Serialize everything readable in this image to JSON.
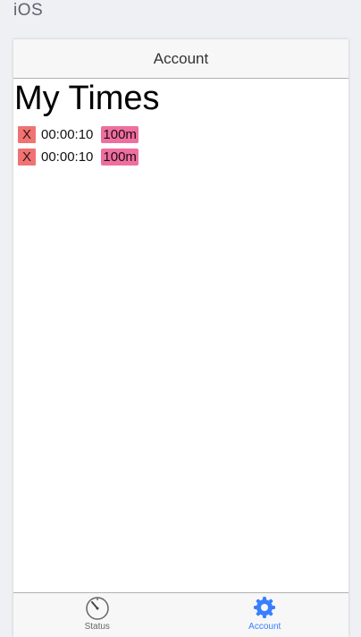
{
  "platform": {
    "label": "iOS"
  },
  "navbar": {
    "title": "Account"
  },
  "main": {
    "title": "My Times",
    "entries": [
      {
        "delete_label": "X",
        "time": "00:00:10",
        "distance": "100m"
      },
      {
        "delete_label": "X",
        "time": "00:00:10",
        "distance": "100m"
      }
    ]
  },
  "tabs": [
    {
      "label": "Status",
      "icon": "stopwatch-icon",
      "active": false
    },
    {
      "label": "Account",
      "icon": "gear-icon",
      "active": true
    }
  ],
  "colors": {
    "active_tab": "#3880ff",
    "inactive_tab": "#666666",
    "delete_button": "#ef7373",
    "distance_badge": "#ee6f9f"
  }
}
